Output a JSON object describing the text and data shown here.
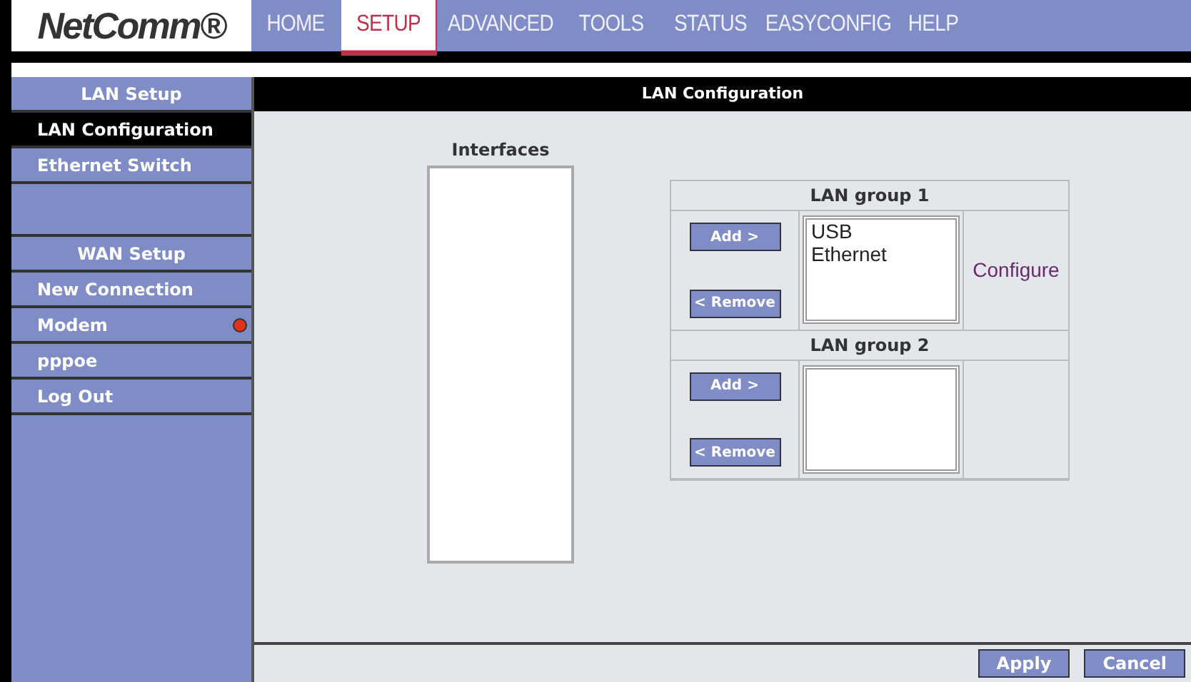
{
  "logo": "NetComm®",
  "tabs": [
    {
      "label": "HOME",
      "selected": false
    },
    {
      "label": "SETUP",
      "selected": true
    },
    {
      "label": "ADVANCED",
      "selected": false
    },
    {
      "label": "TOOLS",
      "selected": false
    },
    {
      "label": "STATUS",
      "selected": false
    },
    {
      "label": "EASYCONFIG",
      "selected": false
    },
    {
      "label": "HELP",
      "selected": false
    }
  ],
  "sidebar": {
    "items": [
      {
        "kind": "header",
        "label": "LAN Setup"
      },
      {
        "kind": "link",
        "label": "LAN Configuration",
        "selected": true
      },
      {
        "kind": "link",
        "label": "Ethernet Switch",
        "selected": false
      },
      {
        "kind": "spacer"
      },
      {
        "kind": "header",
        "label": "WAN Setup"
      },
      {
        "kind": "link",
        "label": "New Connection",
        "selected": false
      },
      {
        "kind": "link",
        "label": "Modem",
        "selected": false,
        "color": "#e0321a"
      },
      {
        "kind": "link",
        "label": "pppoe",
        "selected": false
      },
      {
        "kind": "link",
        "label": "Log Out",
        "selected": false
      }
    ]
  },
  "page_title": "LAN Configuration",
  "interfaces": {
    "label": "Interfaces"
  },
  "groups": [
    {
      "title": "LAN group 1",
      "add": "Add >",
      "remove": "< Remove",
      "items": [
        "USB",
        "Ethernet"
      ],
      "link": "Configure"
    },
    {
      "title": "LAN group 2",
      "add": "Add >",
      "remove": "< Remove"
    }
  ],
  "buttons": [
    "Apply",
    "Cancel"
  ]
}
